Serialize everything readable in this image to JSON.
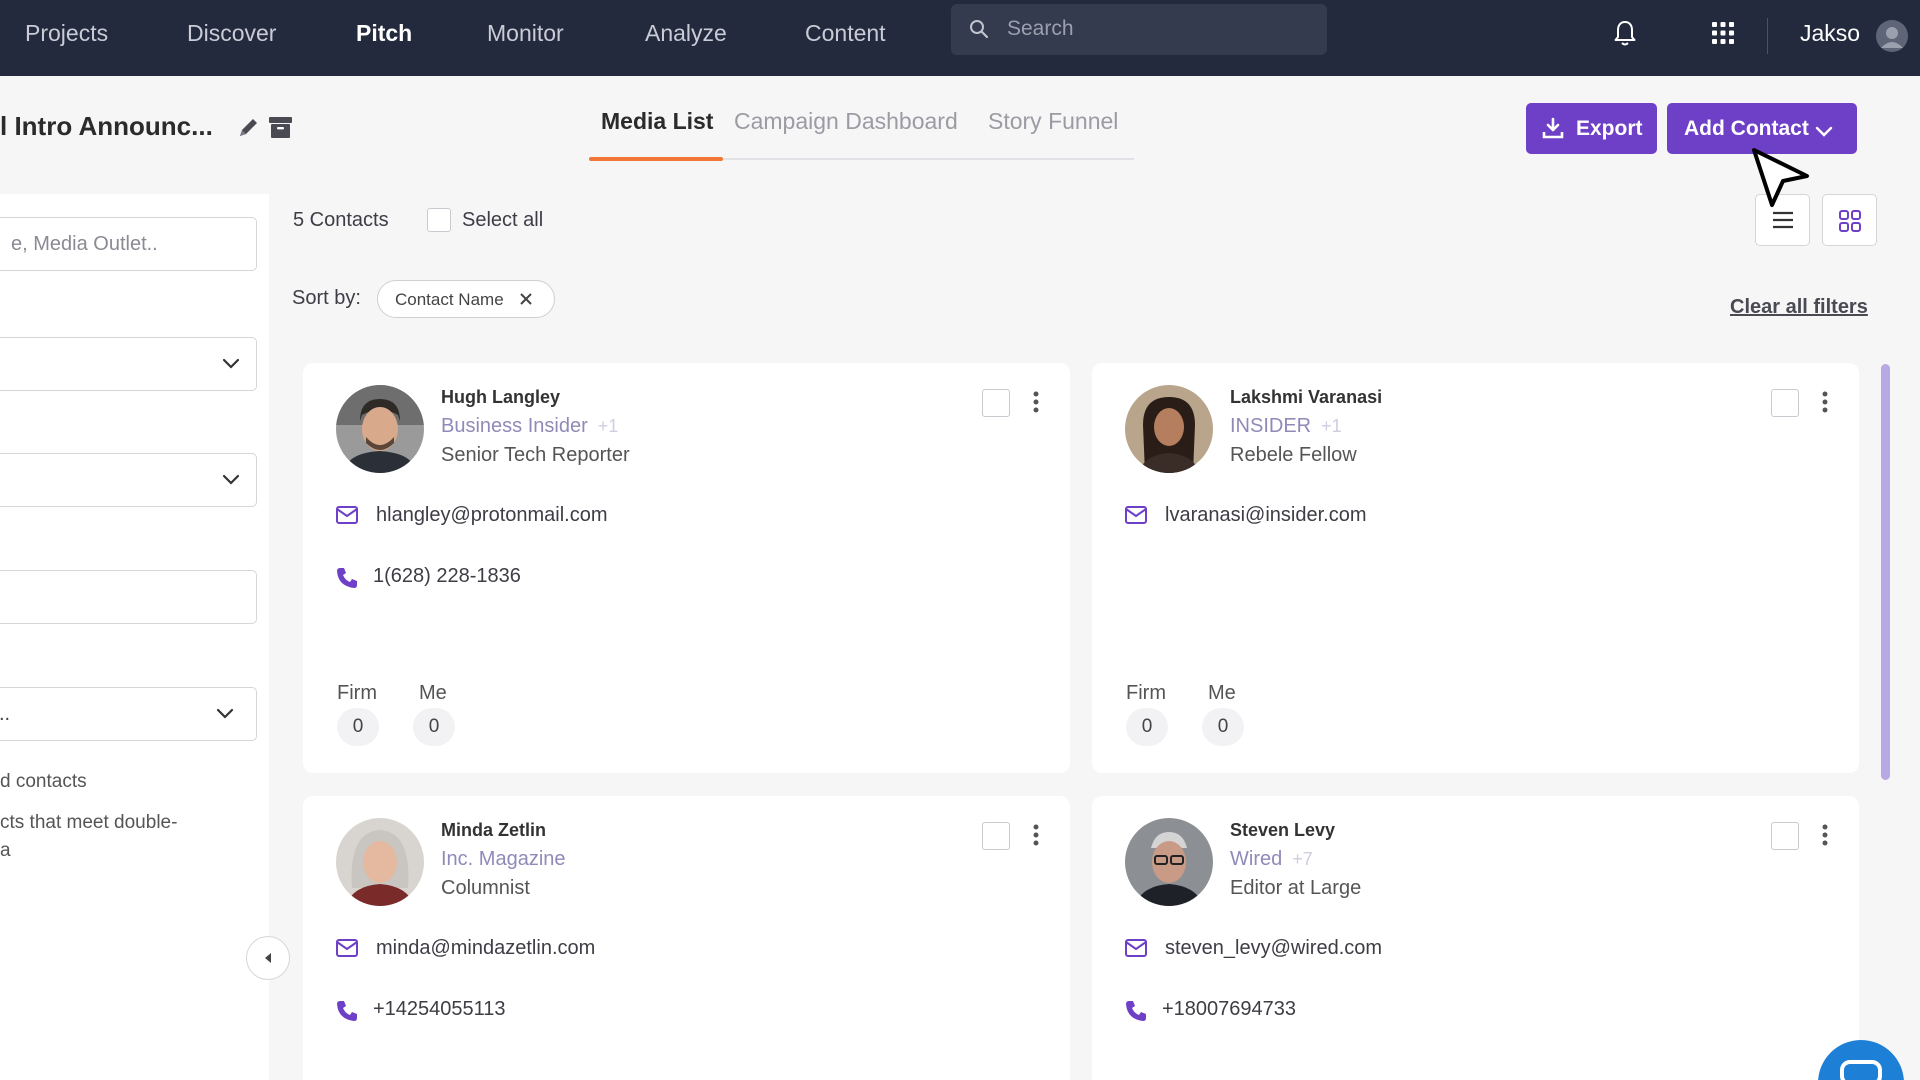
{
  "nav": {
    "items": [
      "Projects",
      "Discover",
      "Pitch",
      "Monitor",
      "Analyze",
      "Content"
    ],
    "active": "Pitch",
    "search_placeholder": "Search",
    "user_name": "Jakso"
  },
  "campaign": {
    "title": "l Intro Announc...",
    "tabs": [
      "Media List",
      "Campaign Dashboard",
      "Story Funnel"
    ],
    "active_tab": "Media List"
  },
  "actions": {
    "export_label": "Export",
    "add_contact_label": "Add Contact"
  },
  "filters": {
    "search_placeholder": "e, Media Outlet..",
    "dropdown3_value": "..",
    "text1": "d contacts",
    "text2": "cts that meet double-",
    "text3": "a"
  },
  "list": {
    "count_label": "5 Contacts",
    "select_all_label": "Select all",
    "sort_label": "Sort by:",
    "sort_chip": "Contact Name",
    "clear_filters": "Clear all filters"
  },
  "stat_labels": [
    "Firm",
    "Me"
  ],
  "contacts": [
    {
      "name": "Hugh Langley",
      "outlet": "Business Insider",
      "extra": "+1",
      "role": "Senior Tech Reporter",
      "email": "hlangley@protonmail.com",
      "phone": "1(628) 228-1836",
      "firm": "0",
      "me": "0"
    },
    {
      "name": "Lakshmi Varanasi",
      "outlet": "INSIDER",
      "extra": "+1",
      "role": "Rebele Fellow",
      "email": "lvaranasi@insider.com",
      "phone": "",
      "firm": "0",
      "me": "0"
    },
    {
      "name": "Minda Zetlin",
      "outlet": "Inc. Magazine",
      "extra": "",
      "role": "Columnist",
      "email": "minda@mindazetlin.com",
      "phone": "+14254055113",
      "firm": "",
      "me": ""
    },
    {
      "name": "Steven Levy",
      "outlet": "Wired",
      "extra": "+7",
      "role": "Editor at Large",
      "email": "steven_levy@wired.com",
      "phone": "+18007694733",
      "firm": "",
      "me": ""
    }
  ],
  "colors": {
    "nav_bg": "#232a3d",
    "accent": "#6e3fc7",
    "tab_underline": "#f27636"
  }
}
